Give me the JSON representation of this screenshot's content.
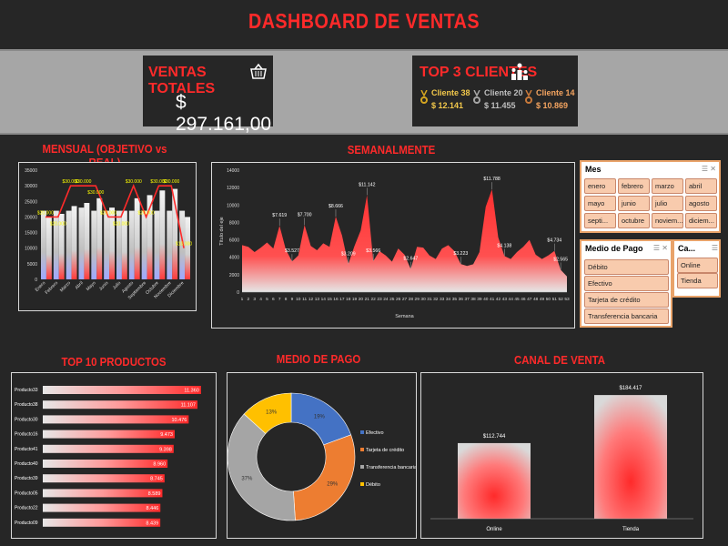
{
  "header": {
    "title": "DASHBOARD DE VENTAS"
  },
  "kpi": {
    "total_label": "VENTAS TOTALES",
    "total_value": "$ 297.161,00",
    "top3_label": "TOP 3 CLIENTES",
    "clients": [
      {
        "name": "Cliente 38",
        "value": "$ 12.141",
        "color": "#f2c84b",
        "medal": "#d4a520"
      },
      {
        "name": "Cliente 20",
        "value": "$ 11.455",
        "color": "#bfbfbf",
        "medal": "#a6a6a6"
      },
      {
        "name": "Cliente 14",
        "value": "$ 10.869",
        "color": "#f4a460",
        "medal": "#c8793b"
      }
    ]
  },
  "sections": {
    "mensual": "MENSUAL (OBJETIVO vs REAL)",
    "semanal": "SEMANALMENTE",
    "top10": "TOP 10 PRODUCTOS",
    "medio": "MEDIO DE PAGO",
    "canal": "CANAL DE VENTA"
  },
  "slicers": {
    "mes": {
      "title": "Mes",
      "items": [
        "enero",
        "febrero",
        "marzo",
        "abril",
        "mayo",
        "junio",
        "julio",
        "agosto",
        "septi...",
        "octubre",
        "noviem...",
        "diciem..."
      ]
    },
    "medio": {
      "title": "Medio de Pago",
      "items": [
        "Débito",
        "Efectivo",
        "Tarjeta de crédito",
        "Transferencia bancaria"
      ]
    },
    "canal": {
      "title": "Ca...",
      "items": [
        "Online",
        "Tienda"
      ]
    }
  },
  "chart_data": [
    {
      "type": "bar",
      "title": "MENSUAL (OBJETIVO vs REAL)",
      "categories": [
        "Enero",
        "Febrero",
        "Marzo",
        "Abril",
        "Mayo",
        "Junio",
        "Julio",
        "Agosto",
        "Septiembre",
        "Octubre",
        "Noviembre",
        "Diciembre"
      ],
      "series": [
        {
          "values": [
            20000,
            21000,
            23500,
            24500,
            26000,
            23000,
            22000,
            26000,
            27000,
            28500,
            29000,
            20000
          ]
        },
        {
          "values": [
            22000,
            22000,
            22000,
            23000,
            22000,
            22000,
            22000,
            22000,
            22000,
            22000,
            22000,
            22000
          ]
        },
        {
          "type": "line",
          "values": [
            20000,
            20000,
            30000,
            30000,
            30000,
            20000,
            20000,
            30000,
            20000,
            30000,
            30000,
            10000
          ]
        }
      ],
      "line_labels": [
        "$20.000",
        "$20.000",
        "$30.000",
        "$30.000",
        "$30.000",
        "$20.000",
        "$20.000",
        "$30.000",
        "$20.000",
        "$30.000",
        "$30.000",
        "$10.000"
      ],
      "ylim": [
        0,
        35000
      ],
      "yticks": [
        0,
        5000,
        10000,
        15000,
        20000,
        25000,
        30000,
        35000
      ]
    },
    {
      "type": "area",
      "title": "SEMANALMENTE",
      "xlabel": "Semana",
      "ylabel": "Título del eje",
      "x": [
        1,
        2,
        3,
        4,
        5,
        6,
        7,
        8,
        9,
        10,
        11,
        12,
        13,
        14,
        15,
        16,
        17,
        18,
        19,
        20,
        21,
        22,
        23,
        24,
        25,
        26,
        27,
        28,
        29,
        30,
        31,
        32,
        33,
        34,
        35,
        36,
        37,
        38,
        39,
        40,
        41,
        42,
        43,
        44,
        45,
        46,
        47,
        48,
        49,
        50,
        51,
        52,
        53
      ],
      "values": [
        5400,
        5200,
        4600,
        5100,
        5700,
        5000,
        7619,
        4900,
        3527,
        4200,
        7700,
        5300,
        4800,
        5600,
        5200,
        8666,
        6500,
        3209,
        5300,
        7100,
        11142,
        3566,
        4700,
        4200,
        3500,
        5000,
        4300,
        2647,
        5200,
        5100,
        4200,
        3800,
        5000,
        5400,
        4700,
        3223,
        3000,
        3200,
        4600,
        9800,
        11788,
        6300,
        4138,
        3800,
        4600,
        5200,
        6000,
        4300,
        3800,
        4200,
        4734,
        2565,
        1800
      ],
      "annotations": {
        "7": "$7.619",
        "9": "$3.527",
        "11": "$7.700",
        "16": "$8.666",
        "18": "$3.209",
        "21": "$11.142",
        "22": "$3.566",
        "28": "$2.647",
        "36": "$3.223",
        "41": "$11.788",
        "43": "$4.138",
        "51": "$4.734",
        "52": "$2.565"
      },
      "ylim": [
        0,
        14000
      ],
      "yticks": [
        0,
        2000,
        4000,
        6000,
        8000,
        10000,
        12000,
        14000
      ]
    },
    {
      "type": "bar",
      "orientation": "horizontal",
      "title": "TOP 10 PRODUCTOS",
      "categories": [
        "Producto33",
        "Producto38",
        "Producto30",
        "Producto16",
        "Producto41",
        "Producto40",
        "Producto39",
        "Producto05",
        "Producto22",
        "Producto09"
      ],
      "values": [
        11360,
        11107,
        10476,
        9473,
        9398,
        8960,
        8745,
        8589,
        8446,
        8439
      ],
      "labels": [
        "11.360",
        "11.107",
        "10.476",
        "9.473",
        "9.398",
        "8.960",
        "8.745",
        "8.589",
        "8.446",
        "8.439"
      ]
    },
    {
      "type": "pie",
      "title": "MEDIO DE PAGO",
      "categories": [
        "Efectivo",
        "Tarjeta de crédito",
        "Transferencia bancaria",
        "Débito"
      ],
      "values": [
        19,
        29,
        37,
        13
      ],
      "labels": [
        "19%",
        "29%",
        "37%",
        "13%"
      ],
      "colors": [
        "#4472c4",
        "#ed7d31",
        "#a5a5a5",
        "#ffc000"
      ],
      "legend": "right"
    },
    {
      "type": "bar",
      "title": "CANAL DE VENTA",
      "categories": [
        "Online",
        "Tienda"
      ],
      "values": [
        112744,
        184417
      ],
      "labels": [
        "$112.744",
        "$184.417"
      ]
    }
  ]
}
